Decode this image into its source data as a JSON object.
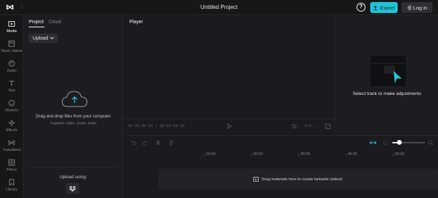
{
  "app": {
    "title": "Untitled Project",
    "export_label": "Export",
    "login_label": "Log in"
  },
  "nav": {
    "items": [
      {
        "label": "Media",
        "icon": "media-icon",
        "active": true
      },
      {
        "label": "Stock videos",
        "icon": "stock-videos-icon",
        "active": false
      },
      {
        "label": "Audio",
        "icon": "audio-icon",
        "active": false
      },
      {
        "label": "Text",
        "icon": "text-icon",
        "active": false
      },
      {
        "label": "Stickers",
        "icon": "stickers-icon",
        "active": false
      },
      {
        "label": "Effects",
        "icon": "effects-icon",
        "active": false
      },
      {
        "label": "Transitions",
        "icon": "transitions-icon",
        "active": false
      },
      {
        "label": "Filters",
        "icon": "filters-icon",
        "active": false
      },
      {
        "label": "Library",
        "icon": "library-icon",
        "active": false
      }
    ]
  },
  "media": {
    "tabs": [
      "Project",
      "Cloud"
    ],
    "upload_label": "Upload",
    "drop_text": "Drag and drop files from your computer",
    "drop_sub": "Supports: video, photo, audio",
    "upload_using": "Upload using:"
  },
  "player": {
    "title": "Player",
    "timecode": "00:00:00:00 / 00:00:00:00",
    "ratio": "9:16"
  },
  "inspector": {
    "hint": "Select track to make adjustments"
  },
  "timeline": {
    "ruler": [
      "10:00",
      "20:00",
      "30:00",
      "40:00",
      "50:00"
    ],
    "zoom_level": 0.2,
    "placeholder": "Drag materials here to create fantastic videos!"
  },
  "colors": {
    "accent": "#22c3d6",
    "background": "#17171a",
    "panel": "#1d1d21"
  }
}
